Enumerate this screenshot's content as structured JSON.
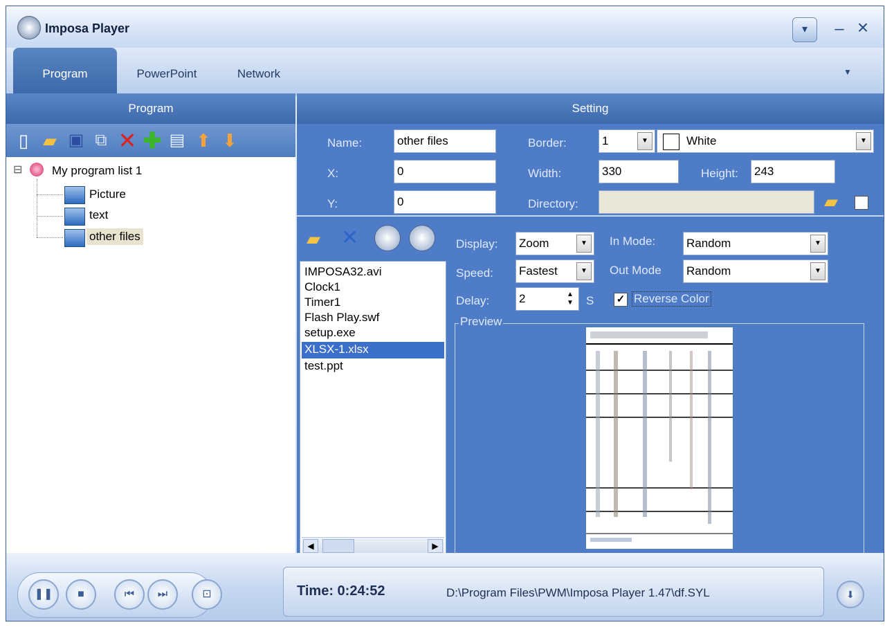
{
  "window": {
    "title": "Imposa Player",
    "controls": {
      "menu": "▾",
      "minimize": "–",
      "close": "×"
    }
  },
  "tabs": [
    {
      "label": "Program"
    },
    {
      "label": "PowerPoint"
    },
    {
      "label": "Network"
    }
  ],
  "program_panel": {
    "header": "Program",
    "toolbar_icons": [
      "new-file-icon",
      "open-folder-icon",
      "save-icon",
      "copy-icon",
      "delete-icon",
      "add-icon",
      "add-item-icon",
      "move-up-icon",
      "move-down-icon"
    ],
    "tree": {
      "root": "My program list 1",
      "expander": "⊟",
      "children": [
        "Picture",
        "text",
        "other files"
      ]
    }
  },
  "setting_panel": {
    "header": "Setting",
    "name_label": "Name:",
    "name_value": "other files",
    "x_label": "X:",
    "x_value": "0",
    "y_label": "Y:",
    "y_value": "0",
    "border_label": "Border:",
    "border_value": "1",
    "border_color": "White",
    "width_label": "Width:",
    "width_value": "330",
    "height_label": "Height:",
    "height_value": "243",
    "directory_label": "Directory:",
    "directory_value": "",
    "display_label": "Display:",
    "display_value": "Zoom",
    "speed_label": "Speed:",
    "speed_value": "Fastest",
    "delay_label": "Delay:",
    "delay_value": "2",
    "delay_unit": "S",
    "in_mode_label": "In Mode:",
    "in_mode_value": "Random",
    "out_mode_label": "Out Mode",
    "out_mode_value": "Random",
    "reverse_color_label": "Reverse Color",
    "reverse_color_checked": true,
    "preview_label": "Preview",
    "files": [
      "IMPOSA32.avi",
      "Clock1",
      "Timer1",
      "Flash Play.swf",
      "setup.exe",
      "XLSX-1.xlsx",
      "test.ppt"
    ],
    "selected_file": "XLSX-1.xlsx",
    "list_icons": [
      "add-file-icon",
      "remove-file-icon",
      "move-down-circle-icon",
      "move-up-circle-icon"
    ]
  },
  "status": {
    "time_text": "Time: 0:24:52",
    "path": "D:\\Program Files\\PWM\\Imposa Player 1.47\\df.SYL"
  },
  "colors": {
    "accent": "#3c69ad",
    "panel": "#4f7cc6",
    "selection": "#3b6fc9"
  }
}
